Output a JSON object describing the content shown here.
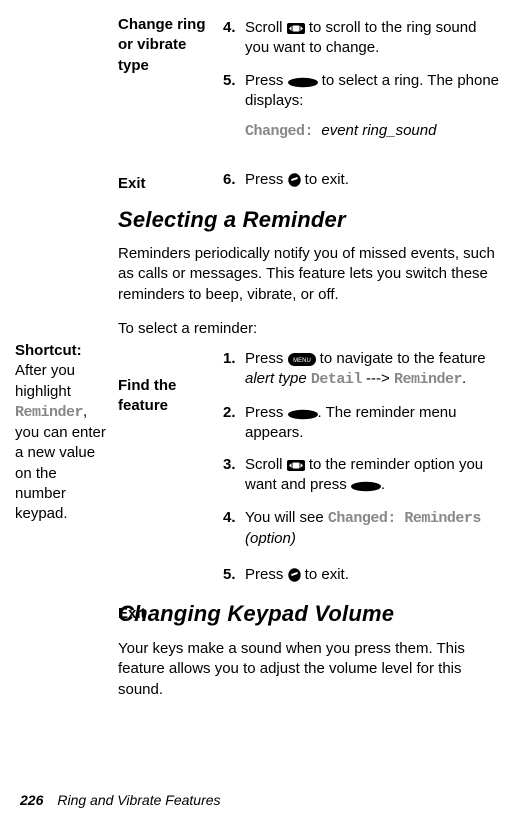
{
  "s1": {
    "label": "Change ring or vibrate type",
    "step4": {
      "n": "4.",
      "a": "Scroll ",
      "b": " to scroll to the ring sound you want to change."
    },
    "step5": {
      "n": "5.",
      "a": "Press ",
      "b": " to select a ring. The phone displays:"
    },
    "changed": {
      "a": "Changed:",
      "b": "event  ring_sound"
    },
    "exitLabel": "Exit",
    "step6": {
      "n": "6.",
      "a": "Press ",
      "b": " to exit."
    }
  },
  "sec2": {
    "title": "Selecting a Reminder",
    "p1": "Reminders periodically notify you of missed events, such as calls or messages. This feature lets you switch these reminders to beep, vibrate, or off.",
    "shortcut": {
      "a": "Shortcut:",
      "b": "After you highlight ",
      "c": "Reminder",
      "d": ", you can enter a new value on the number keypad."
    },
    "intro": "To select a reminder:",
    "findLabel": "Find the feature",
    "step1": {
      "n": "1.",
      "a": "Press ",
      "b": " to navigate to the feature ",
      "c": "alert type ",
      "d": "Detail",
      "e": " ---> ",
      "f": "Reminder",
      "g": "."
    },
    "step2": {
      "n": "2.",
      "a": "Press ",
      "b": ". The reminder menu appears."
    },
    "step3": {
      "n": "3.",
      "a": "Scroll ",
      "b": " to the reminder option you want and press ",
      "c": "."
    },
    "step4": {
      "n": "4.",
      "a": "You will see ",
      "b": "Changed: Reminders",
      "c": "(option)"
    },
    "exitLabel": "Exit",
    "step5": {
      "n": "5.",
      "a": "Press ",
      "b": " to exit."
    }
  },
  "sec3": {
    "title": "Changing Keypad Volume",
    "p1": "Your keys make a sound when you press them. This feature allows you to adjust the volume level for this sound."
  },
  "footer": {
    "page": "226",
    "title": "Ring and Vibrate Features"
  }
}
